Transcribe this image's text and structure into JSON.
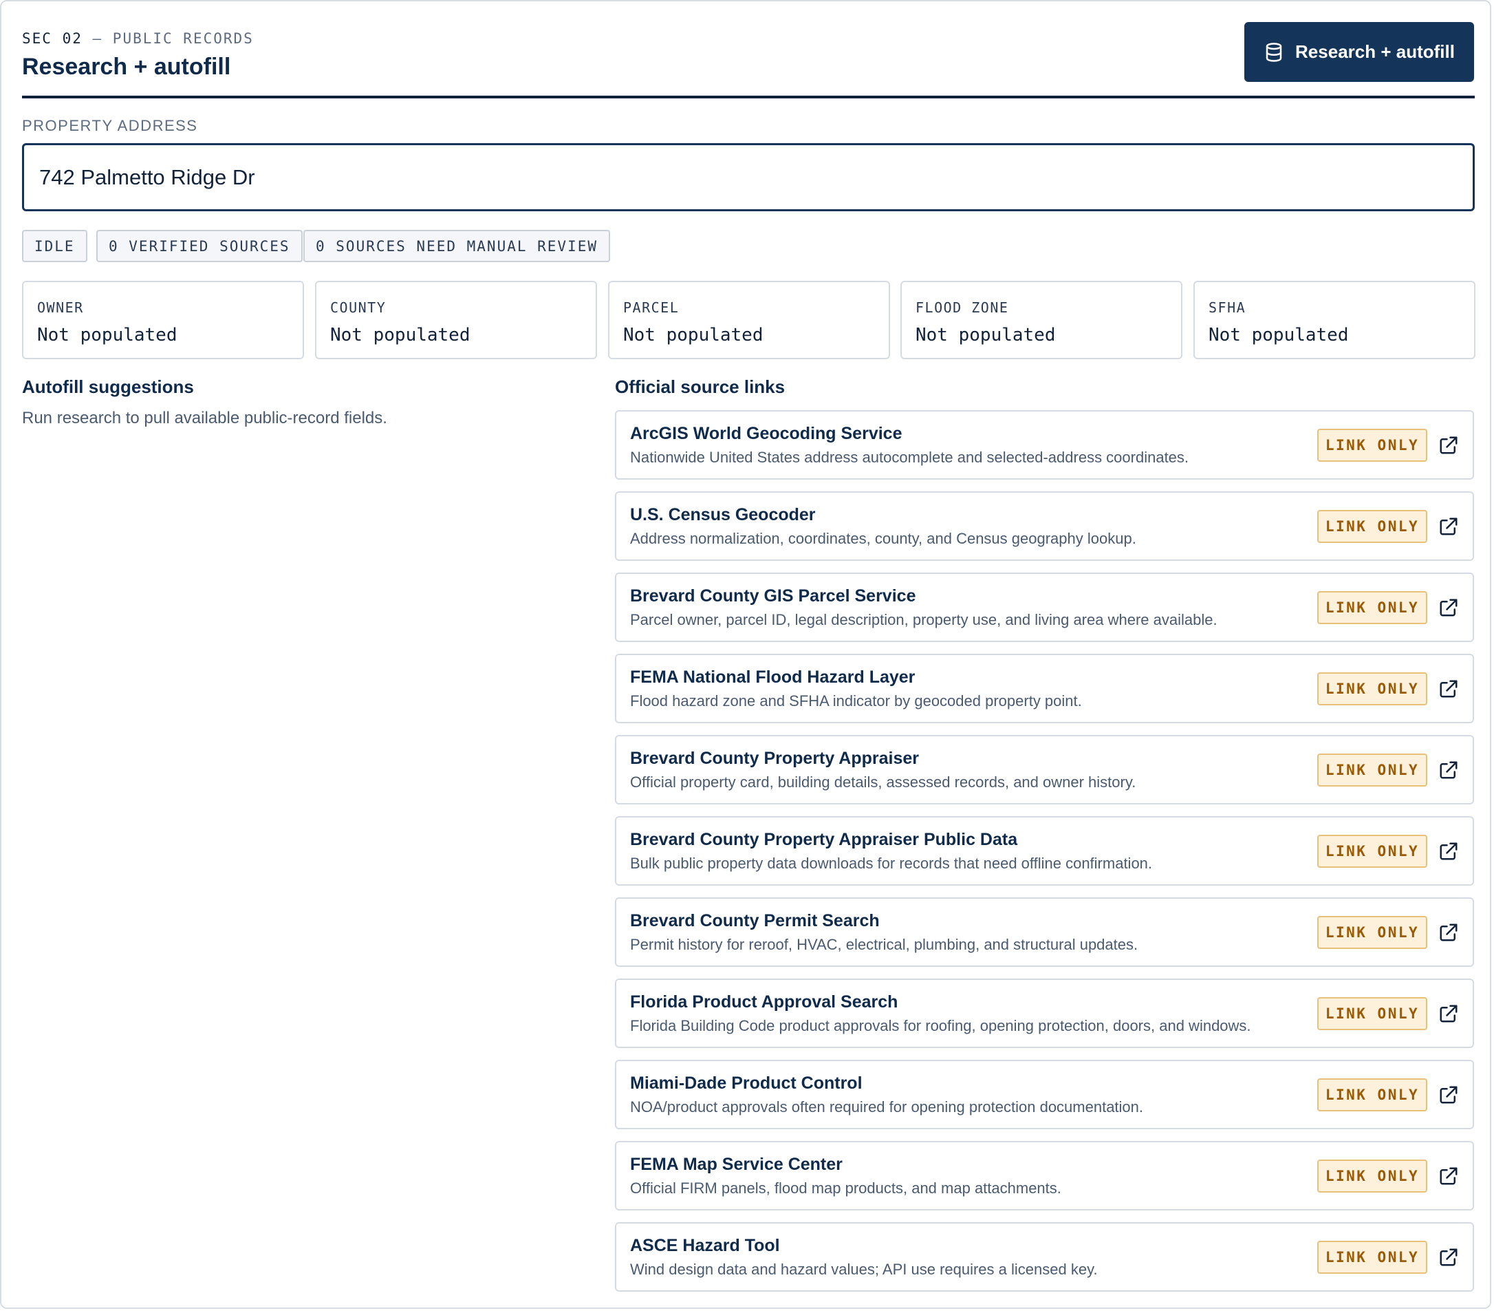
{
  "header": {
    "section_code": "SEC 02",
    "section_sep": " — ",
    "section_name": "PUBLIC RECORDS",
    "title": "Research + autofill",
    "primary_button_label": "Research + autofill",
    "primary_button_icon": "database-icon"
  },
  "address": {
    "label": "PROPERTY ADDRESS",
    "value": "742 Palmetto Ridge Dr"
  },
  "status": {
    "state": "IDLE",
    "verified": "0 VERIFIED SOURCES",
    "review": "0 SOURCES NEED MANUAL REVIEW"
  },
  "summary": [
    {
      "label": "OWNER",
      "value": "Not populated"
    },
    {
      "label": "COUNTY",
      "value": "Not populated"
    },
    {
      "label": "PARCEL",
      "value": "Not populated"
    },
    {
      "label": "FLOOD ZONE",
      "value": "Not populated"
    },
    {
      "label": "SFHA",
      "value": "Not populated"
    }
  ],
  "autofill": {
    "heading": "Autofill suggestions",
    "empty_text": "Run research to pull available public-record fields."
  },
  "sources": {
    "heading": "Official source links",
    "badge_label": "LINK ONLY",
    "link_icon": "external-link-icon",
    "items": [
      {
        "name": "ArcGIS World Geocoding Service",
        "desc": "Nationwide United States address autocomplete and selected-address coordinates."
      },
      {
        "name": "U.S. Census Geocoder",
        "desc": "Address normalization, coordinates, county, and Census geography lookup."
      },
      {
        "name": "Brevard County GIS Parcel Service",
        "desc": "Parcel owner, parcel ID, legal description, property use, and living area where available."
      },
      {
        "name": "FEMA National Flood Hazard Layer",
        "desc": "Flood hazard zone and SFHA indicator by geocoded property point."
      },
      {
        "name": "Brevard County Property Appraiser",
        "desc": "Official property card, building details, assessed records, and owner history."
      },
      {
        "name": "Brevard County Property Appraiser Public Data",
        "desc": "Bulk public property data downloads for records that need offline confirmation."
      },
      {
        "name": "Brevard County Permit Search",
        "desc": "Permit history for reroof, HVAC, electrical, plumbing, and structural updates."
      },
      {
        "name": "Florida Product Approval Search",
        "desc": "Florida Building Code product approvals for roofing, opening protection, doors, and windows."
      },
      {
        "name": "Miami-Dade Product Control",
        "desc": "NOA/product approvals often required for opening protection documentation."
      },
      {
        "name": "FEMA Map Service Center",
        "desc": "Official FIRM panels, flood map products, and map attachments."
      },
      {
        "name": "ASCE Hazard Tool",
        "desc": "Wind design data and hazard values; API use requires a licensed key."
      }
    ]
  }
}
